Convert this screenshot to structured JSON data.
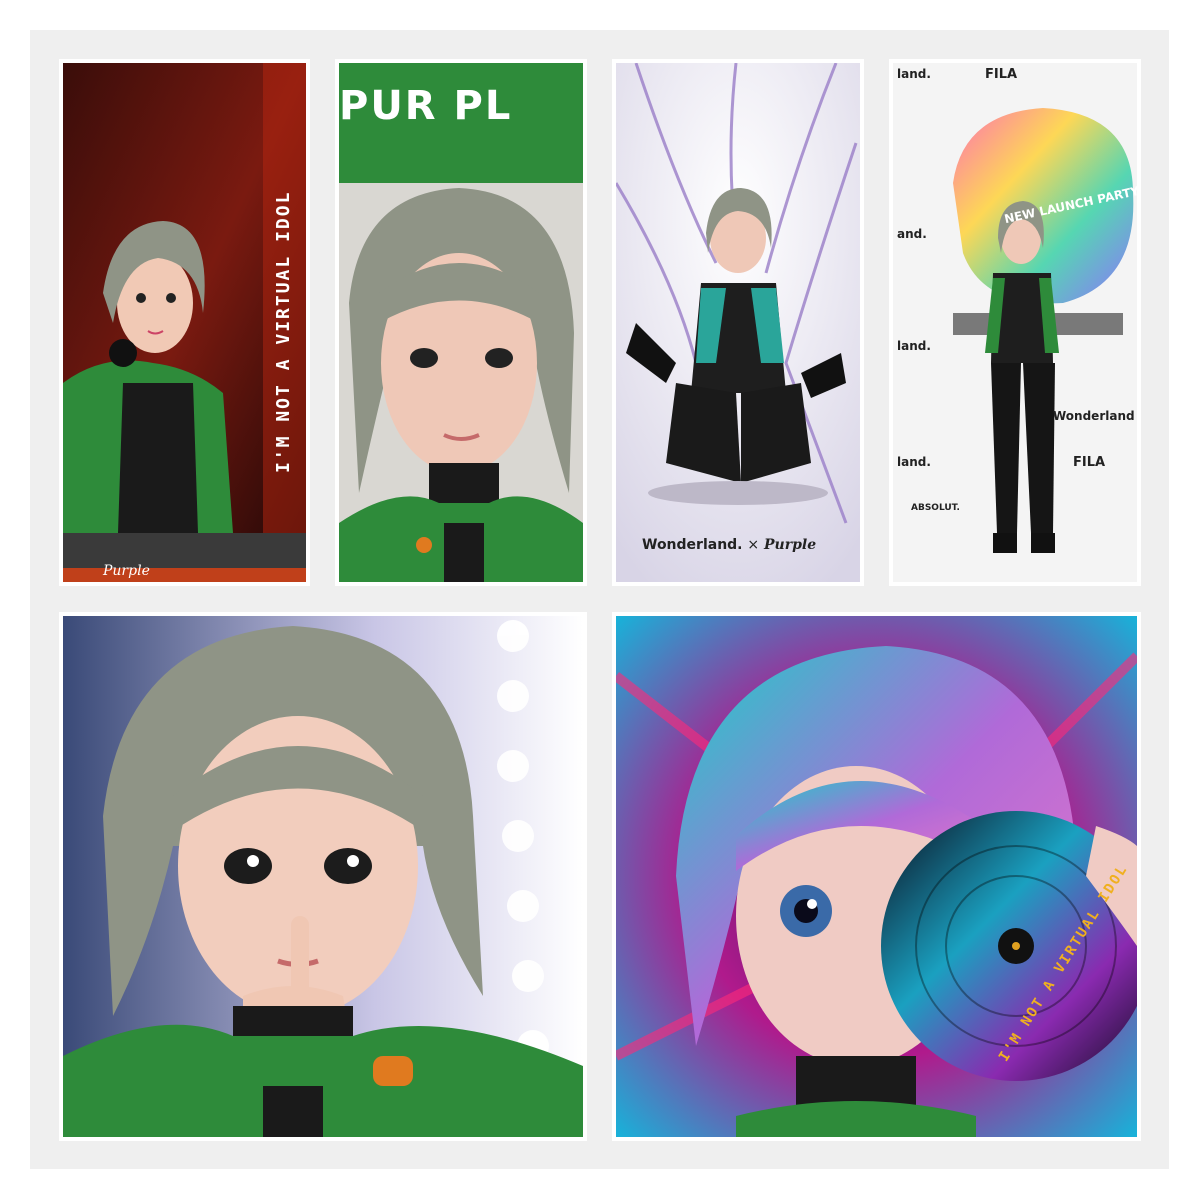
{
  "tiles": {
    "dj_poster": {
      "vertical_text": "I'M NOT A VIRTUAL IDOL",
      "logo": "Purple"
    },
    "closeup_poster": {
      "banner_text": "PUR PL"
    },
    "wires_poster": {
      "brand_left": "Wonderland.",
      "x_mark": "×",
      "brand_right": "Purple"
    },
    "launch_party": {
      "wall_brands": [
        "land.",
        "FILA",
        "and.",
        "land.",
        "Wonderland",
        "land.",
        "FILA",
        "ABSOLUT."
      ],
      "sign_text": "NEW LAUNCH PARTY"
    },
    "vanity_portrait": {},
    "vinyl_portrait": {
      "record_text": "I'M NOT A VIRTUAL IDOL"
    }
  },
  "colors": {
    "background": "#efefef",
    "jacket_green": "#2e8b3a",
    "hair_gray": "#8f9486",
    "accent_orange": "#e07a1f"
  }
}
